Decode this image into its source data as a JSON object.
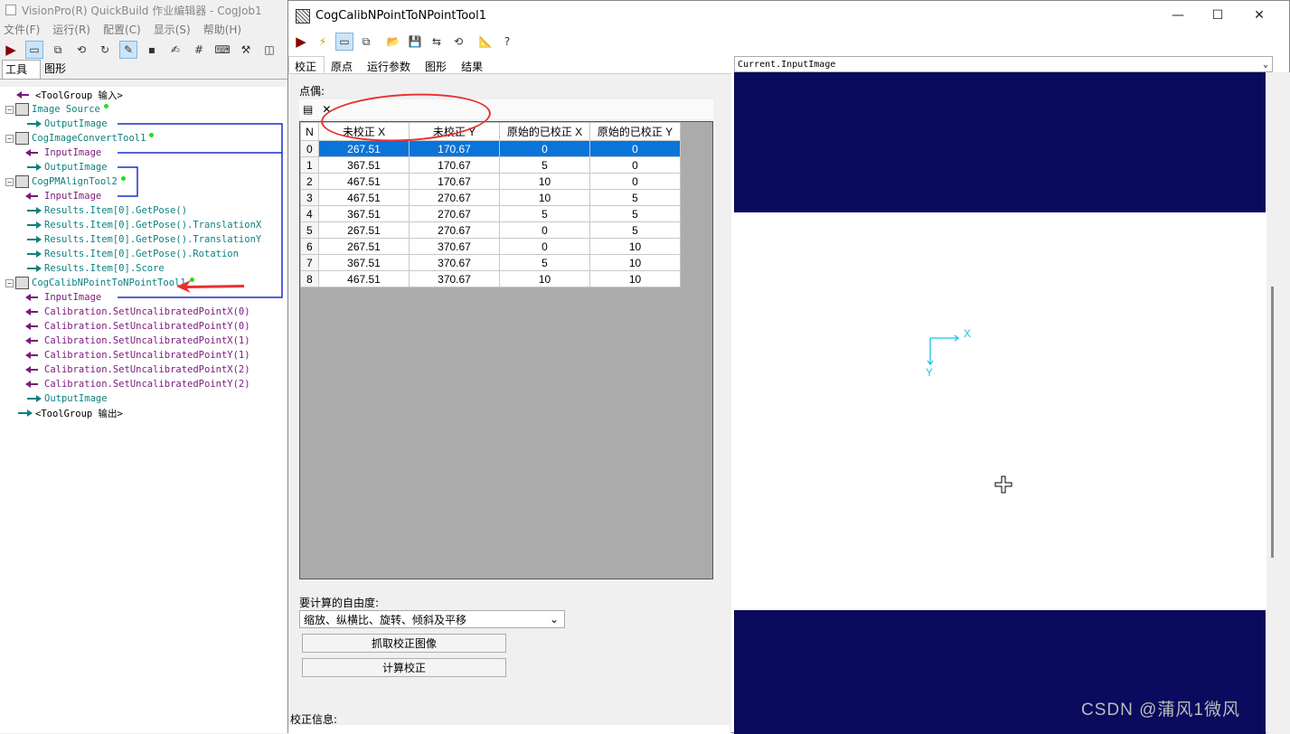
{
  "bg_window": {
    "title": "VisionPro(R) QuickBuild 作业编辑器 - CogJob1",
    "menu": [
      "文件(F)",
      "运行(R)",
      "配置(C)",
      "显示(S)",
      "帮助(H)"
    ],
    "tabs": [
      "工具",
      "图形"
    ],
    "tree": [
      {
        "label": "<ToolGroup 输入>",
        "kind": "group",
        "color": "purp"
      },
      {
        "label": "Image Source",
        "kind": "tool"
      },
      {
        "label": "OutputImage",
        "kind": "out"
      },
      {
        "label": "CogImageConvertTool1",
        "kind": "tool"
      },
      {
        "label": "InputImage",
        "kind": "in"
      },
      {
        "label": "OutputImage",
        "kind": "out"
      },
      {
        "label": "CogPMAlignTool2",
        "kind": "tool"
      },
      {
        "label": "InputImage",
        "kind": "in"
      },
      {
        "label": "Results.Item[0].GetPose()",
        "kind": "out"
      },
      {
        "label": "Results.Item[0].GetPose().TranslationX",
        "kind": "out"
      },
      {
        "label": "Results.Item[0].GetPose().TranslationY",
        "kind": "out"
      },
      {
        "label": "Results.Item[0].GetPose().Rotation",
        "kind": "out"
      },
      {
        "label": "Results.Item[0].Score",
        "kind": "out"
      },
      {
        "label": "CogCalibNPointToNPointTool1",
        "kind": "tool"
      },
      {
        "label": "InputImage",
        "kind": "in"
      },
      {
        "label": "Calibration.SetUncalibratedPointX(0)",
        "kind": "in"
      },
      {
        "label": "Calibration.SetUncalibratedPointY(0)",
        "kind": "in"
      },
      {
        "label": "Calibration.SetUncalibratedPointX(1)",
        "kind": "in"
      },
      {
        "label": "Calibration.SetUncalibratedPointY(1)",
        "kind": "in"
      },
      {
        "label": "Calibration.SetUncalibratedPointX(2)",
        "kind": "in"
      },
      {
        "label": "Calibration.SetUncalibratedPointY(2)",
        "kind": "in"
      },
      {
        "label": "OutputImage",
        "kind": "out"
      },
      {
        "label": "<ToolGroup 输出>",
        "kind": "group",
        "color": "teal"
      }
    ]
  },
  "window": {
    "title": "CogCalibNPointToNPointTool1",
    "min_icon": "—",
    "max_icon": "☐",
    "close_icon": "✕",
    "tabs": [
      "校正",
      "原点",
      "运行参数",
      "图形",
      "结果"
    ],
    "selected_tab": 0
  },
  "pairs": {
    "label": "点偶:",
    "columns": [
      "N",
      "未校正 X",
      "未校正 Y",
      "原始的已校正 X",
      "原始的已校正 Y"
    ],
    "rows": [
      [
        "0",
        "267.51",
        "170.67",
        "0",
        "0"
      ],
      [
        "1",
        "367.51",
        "170.67",
        "5",
        "0"
      ],
      [
        "2",
        "467.51",
        "170.67",
        "10",
        "0"
      ],
      [
        "3",
        "467.51",
        "270.67",
        "10",
        "5"
      ],
      [
        "4",
        "367.51",
        "270.67",
        "5",
        "5"
      ],
      [
        "5",
        "267.51",
        "270.67",
        "0",
        "5"
      ],
      [
        "6",
        "267.51",
        "370.67",
        "0",
        "10"
      ],
      [
        "7",
        "367.51",
        "370.67",
        "5",
        "10"
      ],
      [
        "8",
        "467.51",
        "370.67",
        "10",
        "10"
      ]
    ],
    "selected_row": 0
  },
  "dof": {
    "label": "要计算的自由度:",
    "value": "缩放、纵横比、旋转、倾斜及平移"
  },
  "buttons": {
    "grab": "抓取校正图像",
    "compute": "计算校正"
  },
  "info_label": "校正信息:",
  "display": {
    "selector": "Current.InputImage",
    "axis_x": "X",
    "axis_y": "Y",
    "band_color": "#0a0a5e",
    "axis_color": "#19c3e6"
  },
  "watermark": "CSDN @蒲风1微风"
}
